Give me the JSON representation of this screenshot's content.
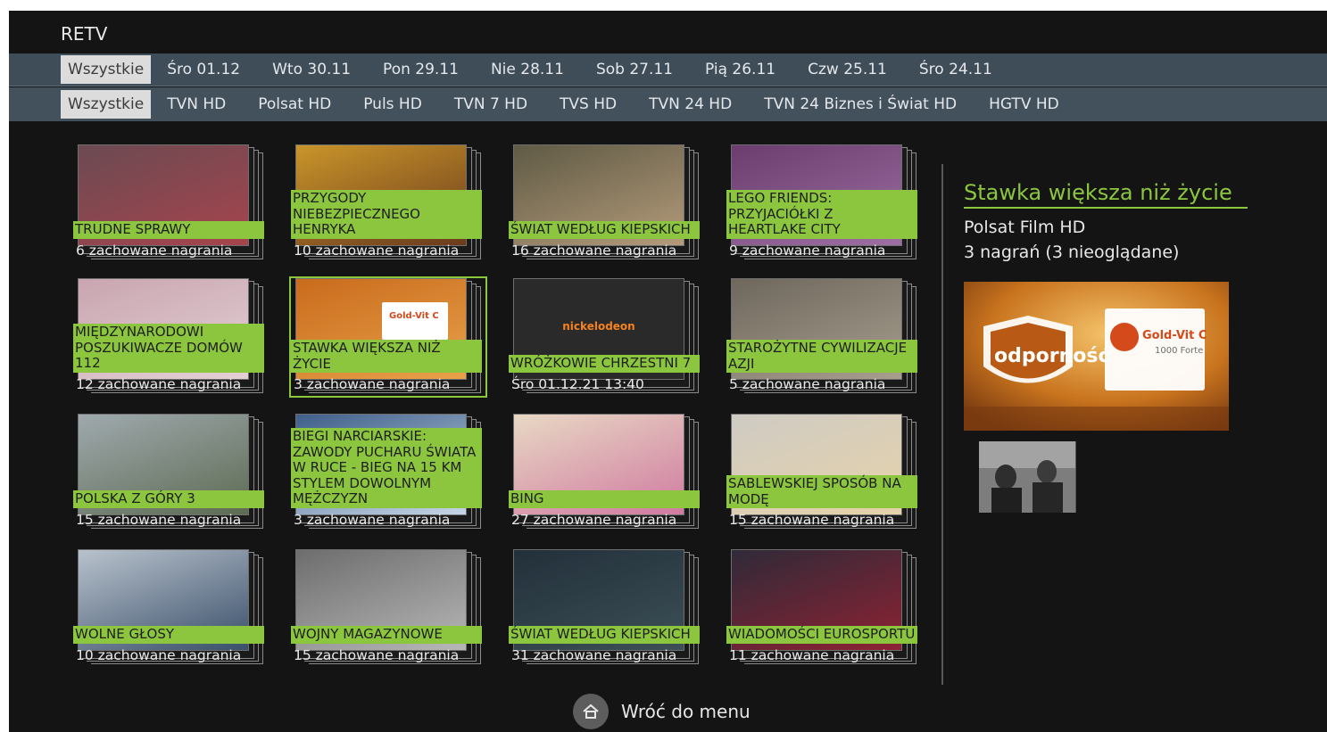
{
  "app": {
    "title": "RETV"
  },
  "dates": [
    "Wszystkie",
    "Śro 01.12",
    "Wto 30.11",
    "Pon 29.11",
    "Nie 28.11",
    "Sob 27.11",
    "Pią 26.11",
    "Czw 25.11",
    "Śro 24.11"
  ],
  "channels": [
    "Wszystkie",
    "TVN HD",
    "Polsat HD",
    "Puls HD",
    "TVN 7 HD",
    "TVS HD",
    "TVN 24 HD",
    "TVN 24 Biznes i Świat HD",
    "HGTV HD"
  ],
  "tiles": [
    {
      "title": "TRUDNE SPRAWY",
      "sub": "6 zachowane nagrania",
      "colors": [
        "#6b4a52",
        "#a7444d"
      ]
    },
    {
      "title": "PRZYGODY NIEBEZPIECZNEGO HENRYKA",
      "sub": "10 zachowane nagrania",
      "colors": [
        "#c9952a",
        "#6b3a1c"
      ]
    },
    {
      "title": "ŚWIAT WEDŁUG KIEPSKICH",
      "sub": "16 zachowane nagrania",
      "colors": [
        "#5f5a45",
        "#b49b7a"
      ]
    },
    {
      "title": "LEGO FRIENDS: PRZYJACIÓŁKI Z HEARTLAKE CITY",
      "sub": "9 zachowane nagrania",
      "colors": [
        "#6b3d6e",
        "#9e6fa3"
      ]
    },
    {
      "title": "MIĘDZYNARODOWI POSZUKIWACZE DOMÓW 112",
      "sub": "12 zachowane nagrania",
      "colors": [
        "#c9a5b0",
        "#e3d0d4"
      ]
    },
    {
      "title": "STAWKA WIĘKSZA NIŻ ŻYCIE",
      "sub": "3 zachowane nagrania",
      "colors": [
        "#c96b1c",
        "#e8a14a"
      ]
    },
    {
      "title": "WRÓŻKOWIE CHRZESTNI 7",
      "sub": "Śro 01.12.21 13:40",
      "colors": [
        "#2e2e2e",
        "#3c3c3c"
      ]
    },
    {
      "title": "STAROŻYTNE CYWILIZACJE AZJI",
      "sub": "5 zachowane nagrania",
      "colors": [
        "#6e675c",
        "#a79e8e"
      ]
    },
    {
      "title": "POLSKA Z GÓRY 3",
      "sub": "15 zachowane nagrania",
      "colors": [
        "#9fa9ae",
        "#5d6b52"
      ]
    },
    {
      "title": "BIEGI NARCIARSKIE: ZAWODY PUCHARU ŚWIATA W RUCE - BIEG NA 15 KM STYLEM DOWOLNYM MĘŻCZYZN",
      "sub": "3 zachowane nagrania",
      "colors": [
        "#3f5f8a",
        "#c6d6e6"
      ]
    },
    {
      "title": "BING",
      "sub": "27 zachowane nagrania",
      "colors": [
        "#e8d8c4",
        "#d07aa0"
      ]
    },
    {
      "title": "SABLEWSKIEJ SPOSÓB NA MODĘ",
      "sub": "15 zachowane nagrania",
      "colors": [
        "#cfcbc4",
        "#e6d2a8"
      ]
    },
    {
      "title": "WOLNE GŁOSY",
      "sub": "10 zachowane nagrania",
      "colors": [
        "#b8c2cc",
        "#3a4f6a"
      ]
    },
    {
      "title": "WOJNY MAGAZYNOWE",
      "sub": "15 zachowane nagrania",
      "colors": [
        "#6d6d6d",
        "#b7b7b7"
      ]
    },
    {
      "title": "ŚWIAT WEDŁUG KIEPSKICH",
      "sub": "31 zachowane nagrania",
      "colors": [
        "#22303a",
        "#3c4f57"
      ]
    },
    {
      "title": "WIADOMOŚCI EUROSPORTU",
      "sub": "11 zachowane nagrania",
      "colors": [
        "#2f2a38",
        "#8e2233"
      ]
    }
  ],
  "selected_index": 5,
  "detail": {
    "title": "Stawka większa niż życie",
    "channel": "Polsat Film HD",
    "recordings": "3 nagrań (3 nieoglądane)",
    "preview_brand": "odporność",
    "preview_product": "Gold-Vit C",
    "preview_strength": "1000 Forte"
  },
  "tile_art": {
    "nickelodeon": "nickelodeon",
    "gold_vit": "Gold-Vit C"
  },
  "footer": {
    "back_label": "Wróć do menu"
  },
  "colors": {
    "accent": "#8cc63f",
    "bar": "#3f4d59",
    "background": "#141414"
  }
}
